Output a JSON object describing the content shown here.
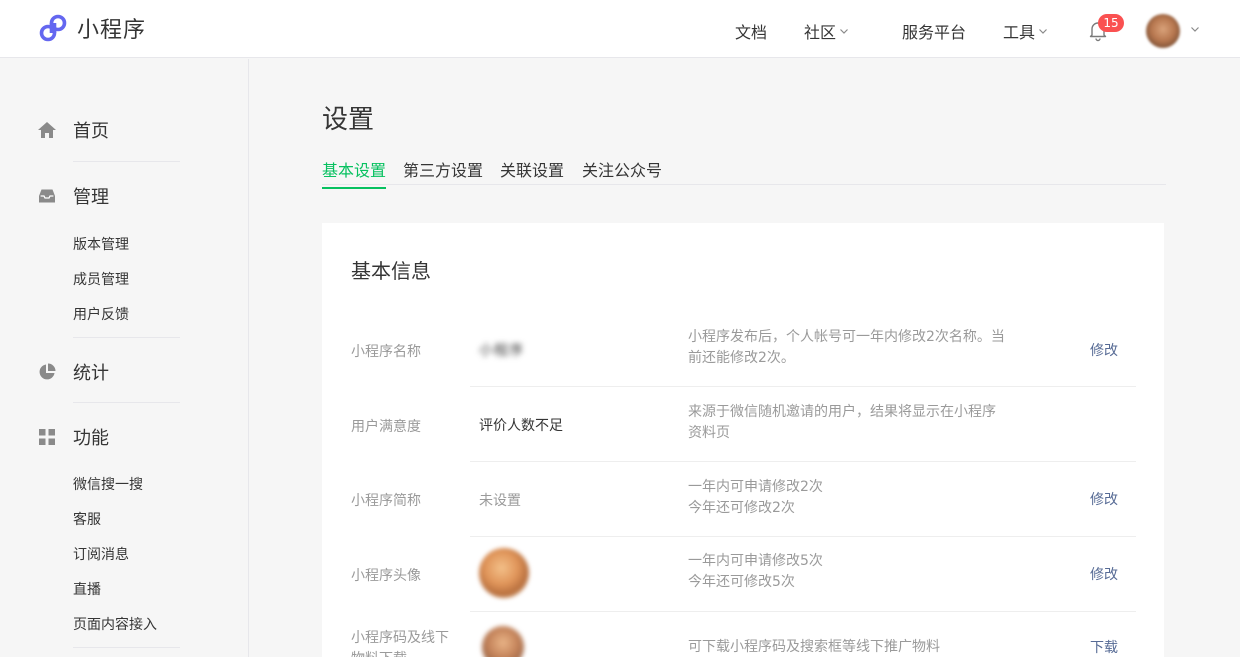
{
  "header": {
    "brand_name": "小程序",
    "nav": [
      {
        "label": "文档",
        "dropdown": false
      },
      {
        "label": "社区",
        "dropdown": true
      },
      {
        "label": "服务平台",
        "dropdown": false
      },
      {
        "label": "工具",
        "dropdown": true
      }
    ],
    "notification_count": "15",
    "accent_color": "#07c160",
    "badge_color": "#fa5151"
  },
  "sidebar": {
    "sections": [
      {
        "label": "首页",
        "icon": "home-icon"
      },
      {
        "label": "管理",
        "icon": "inbox-icon"
      },
      {
        "label": "统计",
        "icon": "pie-chart-icon"
      },
      {
        "label": "功能",
        "icon": "grid-icon"
      }
    ],
    "manage_items": [
      "版本管理",
      "成员管理",
      "用户反馈"
    ],
    "feature_items": [
      "微信搜一搜",
      "客服",
      "订阅消息",
      "直播",
      "页面内容接入"
    ]
  },
  "main": {
    "title": "设置",
    "tabs": [
      "基本设置",
      "第三方设置",
      "关联设置",
      "关注公众号"
    ],
    "active_tab": "基本设置",
    "card_title": "基本信息",
    "rows": [
      {
        "label": "小程序名称",
        "value": "小程序",
        "desc": "小程序发布后，个人帐号可一年内修改2次名称。当前还能修改2次。",
        "action": "修改"
      },
      {
        "label": "用户满意度",
        "value": "评价人数不足",
        "desc": "来源于微信随机邀请的用户，结果将显示在小程序资料页",
        "action": ""
      },
      {
        "label": "小程序简称",
        "value": "未设置",
        "desc_line1": "一年内可申请修改2次",
        "desc_line2": "今年还可修改2次",
        "action": "修改"
      },
      {
        "label": "小程序头像",
        "desc_line1": "一年内可申请修改5次",
        "desc_line2": "今年还可修改5次",
        "action": "修改"
      },
      {
        "label": "小程序码及线下物料下载",
        "desc": "可下载小程序码及搜索框等线下推广物料",
        "action": "下载"
      }
    ]
  }
}
